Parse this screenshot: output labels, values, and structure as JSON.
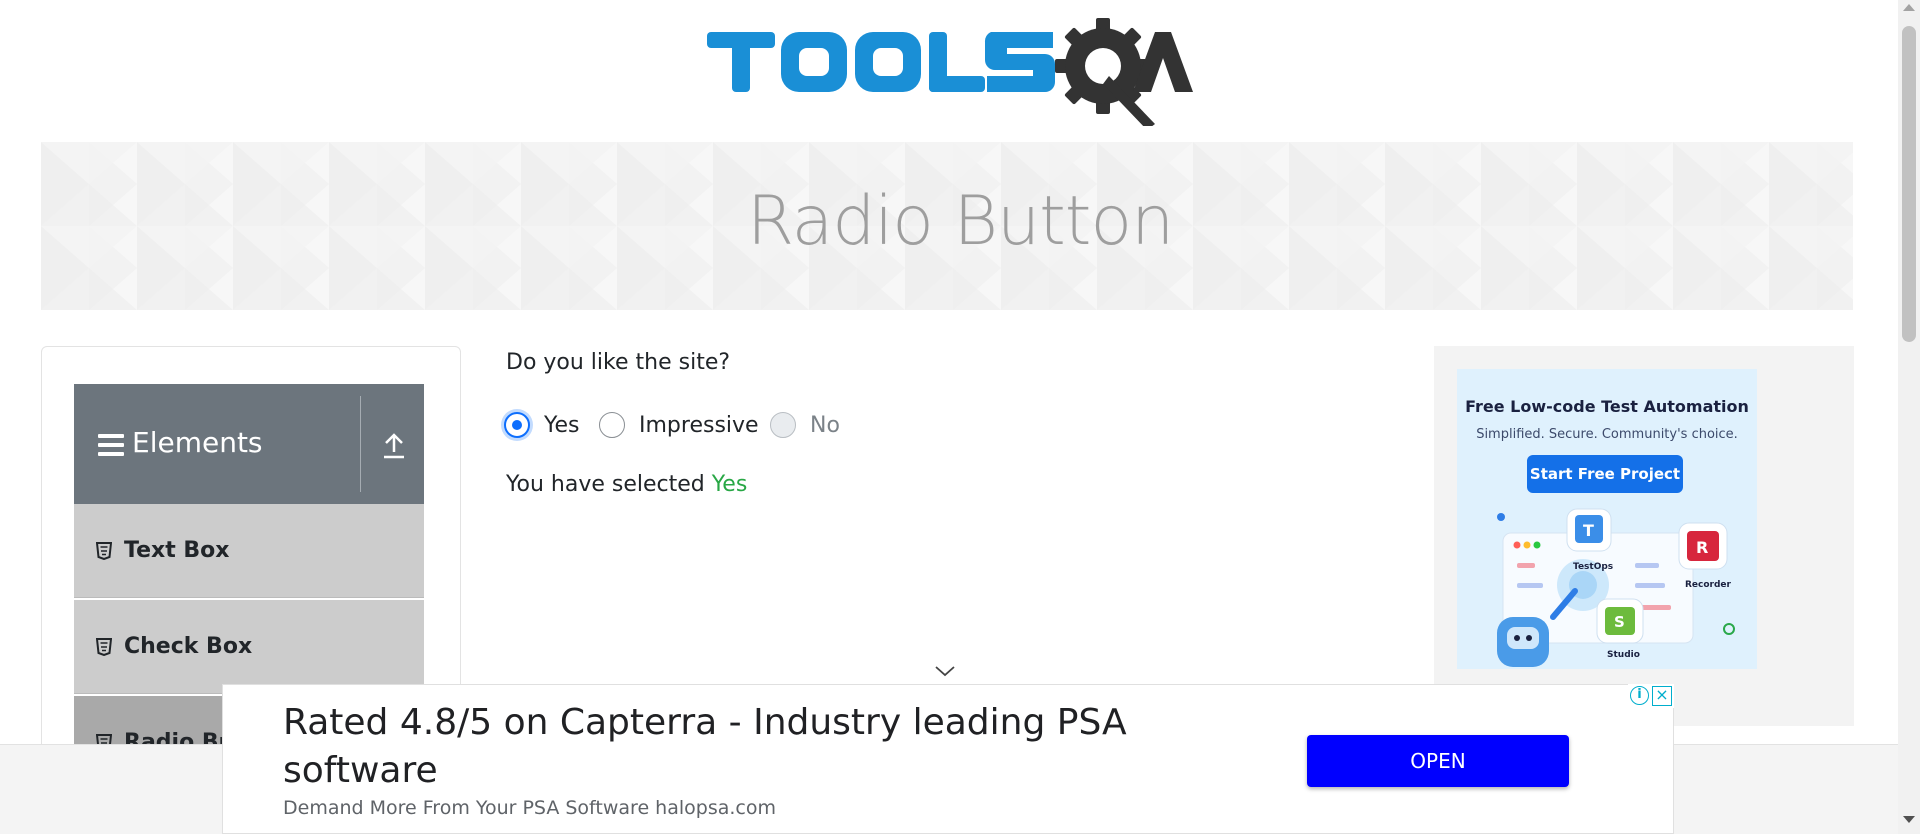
{
  "header": {
    "logo_text": "TOOLSQA"
  },
  "banner": {
    "title": "Radio Button"
  },
  "sidebar": {
    "group_title": "Elements",
    "items": [
      {
        "label": "Text Box"
      },
      {
        "label": "Check Box"
      },
      {
        "label": "Radio Button"
      }
    ]
  },
  "main": {
    "question": "Do you like the site?",
    "options": [
      {
        "label": "Yes",
        "state": "checked"
      },
      {
        "label": "Impressive",
        "state": "unchecked"
      },
      {
        "label": "No",
        "state": "disabled"
      }
    ],
    "result_prefix": "You have selected",
    "result_value": "Yes"
  },
  "side_ad": {
    "title": "Free Low-code Test Automation",
    "subtitle": "Simplified. Secure. Community's choice.",
    "button": "Start Free Project",
    "labels": [
      "TestOps",
      "Recorder",
      "Studio"
    ]
  },
  "bottom_ad": {
    "headline": "Rated 4.8/5 on Capterra - Industry leading PSA software",
    "subline": "Demand More From Your PSA Software halopsa.com",
    "button": "OPEN"
  },
  "colors": {
    "accent": "#0d6efd",
    "selected_value": "#28a745",
    "sidebar_header": "#6c757d",
    "menu_item": "#cccccc",
    "ad_button": "#0000ff"
  }
}
